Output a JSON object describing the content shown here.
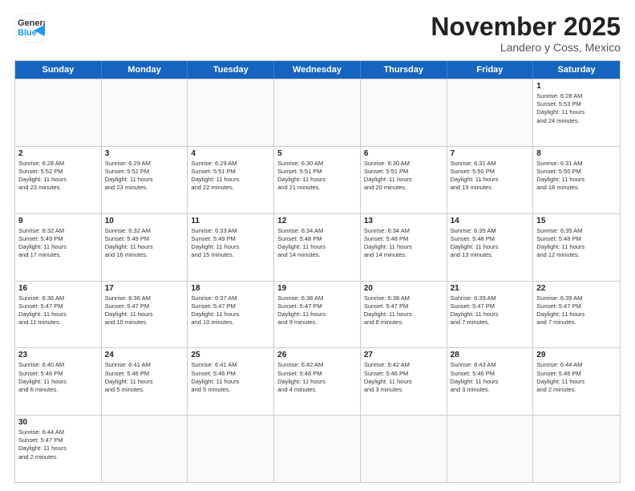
{
  "header": {
    "logo_general": "General",
    "logo_blue": "Blue",
    "month_title": "November 2025",
    "location": "Landero y Coss, Mexico"
  },
  "days": [
    "Sunday",
    "Monday",
    "Tuesday",
    "Wednesday",
    "Thursday",
    "Friday",
    "Saturday"
  ],
  "rows": [
    [
      {
        "date": "",
        "info": ""
      },
      {
        "date": "",
        "info": ""
      },
      {
        "date": "",
        "info": ""
      },
      {
        "date": "",
        "info": ""
      },
      {
        "date": "",
        "info": ""
      },
      {
        "date": "",
        "info": ""
      },
      {
        "date": "1",
        "info": "Sunrise: 6:28 AM\nSunset: 5:53 PM\nDaylight: 11 hours\nand 24 minutes."
      }
    ],
    [
      {
        "date": "2",
        "info": "Sunrise: 6:28 AM\nSunset: 5:52 PM\nDaylight: 11 hours\nand 23 minutes."
      },
      {
        "date": "3",
        "info": "Sunrise: 6:29 AM\nSunset: 5:52 PM\nDaylight: 11 hours\nand 23 minutes."
      },
      {
        "date": "4",
        "info": "Sunrise: 6:29 AM\nSunset: 5:51 PM\nDaylight: 11 hours\nand 22 minutes."
      },
      {
        "date": "5",
        "info": "Sunrise: 6:30 AM\nSunset: 5:51 PM\nDaylight: 11 hours\nand 21 minutes."
      },
      {
        "date": "6",
        "info": "Sunrise: 6:30 AM\nSunset: 5:51 PM\nDaylight: 11 hours\nand 20 minutes."
      },
      {
        "date": "7",
        "info": "Sunrise: 6:31 AM\nSunset: 5:50 PM\nDaylight: 11 hours\nand 19 minutes."
      },
      {
        "date": "8",
        "info": "Sunrise: 6:31 AM\nSunset: 5:50 PM\nDaylight: 11 hours\nand 18 minutes."
      }
    ],
    [
      {
        "date": "9",
        "info": "Sunrise: 6:32 AM\nSunset: 5:49 PM\nDaylight: 11 hours\nand 17 minutes."
      },
      {
        "date": "10",
        "info": "Sunrise: 6:32 AM\nSunset: 5:49 PM\nDaylight: 11 hours\nand 16 minutes."
      },
      {
        "date": "11",
        "info": "Sunrise: 6:33 AM\nSunset: 5:49 PM\nDaylight: 11 hours\nand 15 minutes."
      },
      {
        "date": "12",
        "info": "Sunrise: 6:34 AM\nSunset: 5:48 PM\nDaylight: 11 hours\nand 14 minutes."
      },
      {
        "date": "13",
        "info": "Sunrise: 6:34 AM\nSunset: 5:48 PM\nDaylight: 11 hours\nand 14 minutes."
      },
      {
        "date": "14",
        "info": "Sunrise: 6:35 AM\nSunset: 5:48 PM\nDaylight: 11 hours\nand 13 minutes."
      },
      {
        "date": "15",
        "info": "Sunrise: 6:35 AM\nSunset: 5:48 PM\nDaylight: 11 hours\nand 12 minutes."
      }
    ],
    [
      {
        "date": "16",
        "info": "Sunrise: 6:36 AM\nSunset: 5:47 PM\nDaylight: 11 hours\nand 11 minutes."
      },
      {
        "date": "17",
        "info": "Sunrise: 6:36 AM\nSunset: 5:47 PM\nDaylight: 11 hours\nand 10 minutes."
      },
      {
        "date": "18",
        "info": "Sunrise: 6:37 AM\nSunset: 5:47 PM\nDaylight: 11 hours\nand 10 minutes."
      },
      {
        "date": "19",
        "info": "Sunrise: 6:38 AM\nSunset: 5:47 PM\nDaylight: 11 hours\nand 9 minutes."
      },
      {
        "date": "20",
        "info": "Sunrise: 6:38 AM\nSunset: 5:47 PM\nDaylight: 11 hours\nand 8 minutes."
      },
      {
        "date": "21",
        "info": "Sunrise: 6:39 AM\nSunset: 5:47 PM\nDaylight: 11 hours\nand 7 minutes."
      },
      {
        "date": "22",
        "info": "Sunrise: 6:39 AM\nSunset: 5:47 PM\nDaylight: 11 hours\nand 7 minutes."
      }
    ],
    [
      {
        "date": "23",
        "info": "Sunrise: 6:40 AM\nSunset: 5:46 PM\nDaylight: 11 hours\nand 6 minutes."
      },
      {
        "date": "24",
        "info": "Sunrise: 6:41 AM\nSunset: 5:46 PM\nDaylight: 11 hours\nand 5 minutes."
      },
      {
        "date": "25",
        "info": "Sunrise: 6:41 AM\nSunset: 5:46 PM\nDaylight: 11 hours\nand 5 minutes."
      },
      {
        "date": "26",
        "info": "Sunrise: 6:42 AM\nSunset: 5:46 PM\nDaylight: 11 hours\nand 4 minutes."
      },
      {
        "date": "27",
        "info": "Sunrise: 6:42 AM\nSunset: 5:46 PM\nDaylight: 11 hours\nand 3 minutes."
      },
      {
        "date": "28",
        "info": "Sunrise: 6:43 AM\nSunset: 5:46 PM\nDaylight: 11 hours\nand 3 minutes."
      },
      {
        "date": "29",
        "info": "Sunrise: 6:44 AM\nSunset: 5:46 PM\nDaylight: 11 hours\nand 2 minutes."
      }
    ],
    [
      {
        "date": "30",
        "info": "Sunrise: 6:44 AM\nSunset: 5:47 PM\nDaylight: 11 hours\nand 2 minutes."
      },
      {
        "date": "",
        "info": ""
      },
      {
        "date": "",
        "info": ""
      },
      {
        "date": "",
        "info": ""
      },
      {
        "date": "",
        "info": ""
      },
      {
        "date": "",
        "info": ""
      },
      {
        "date": "",
        "info": ""
      }
    ]
  ]
}
